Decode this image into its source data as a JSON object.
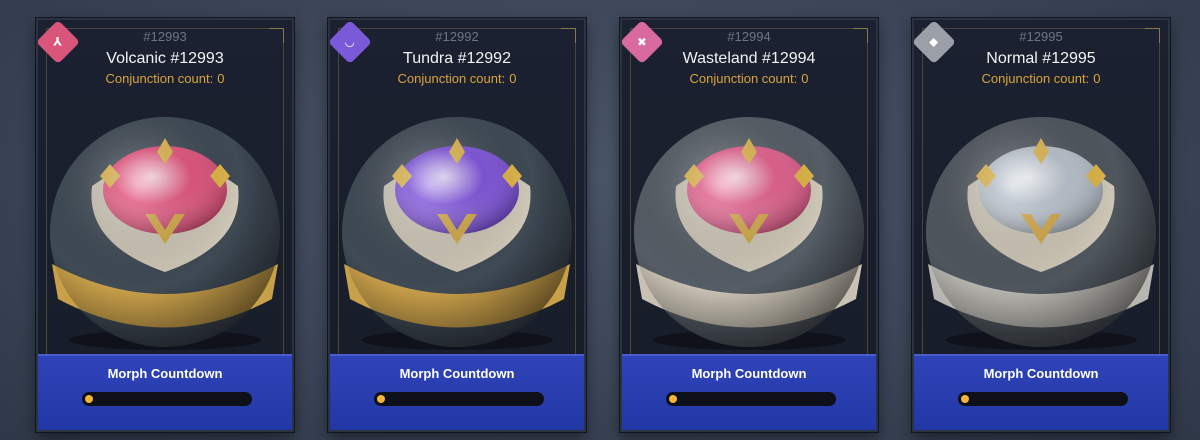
{
  "cards": [
    {
      "serial": "#12993",
      "title": "Volcanic #12993",
      "conjunction_label": "Conjunction count:",
      "conjunction_value": "0",
      "countdown_label": "Morph Countdown",
      "countdown_progress": 0.04,
      "badge_icon": "volcanic-element-icon",
      "badge_glyph": "⅄",
      "badge_color": "#d9557a",
      "gem_color": "#e84a78",
      "band_color": "#c9a04a",
      "shell_color": "#3f4a55"
    },
    {
      "serial": "#12992",
      "title": "Tundra #12992",
      "conjunction_label": "Conjunction count:",
      "conjunction_value": "0",
      "countdown_label": "Morph Countdown",
      "countdown_progress": 0.04,
      "badge_icon": "tundra-element-icon",
      "badge_glyph": "◡",
      "badge_color": "#7a5ad9",
      "gem_color": "#7a4ae0",
      "band_color": "#c9a04a",
      "shell_color": "#3f4a55"
    },
    {
      "serial": "#12994",
      "title": "Wasteland #12994",
      "conjunction_label": "Conjunction count:",
      "conjunction_value": "0",
      "countdown_label": "Morph Countdown",
      "countdown_progress": 0.04,
      "badge_icon": "wasteland-element-icon",
      "badge_glyph": "✖",
      "badge_color": "#d96aa0",
      "gem_color": "#e8588a",
      "band_color": "#c9c2b4",
      "shell_color": "#555d66"
    },
    {
      "serial": "#12995",
      "title": "Normal #12995",
      "conjunction_label": "Conjunction count:",
      "conjunction_value": "0",
      "countdown_label": "Morph Countdown",
      "countdown_progress": 0.04,
      "badge_icon": "normal-element-icon",
      "badge_glyph": "◆",
      "badge_color": "#9a9fa8",
      "gem_color": "#b9c4d0",
      "band_color": "#b8b6b0",
      "shell_color": "#4f565e"
    }
  ]
}
